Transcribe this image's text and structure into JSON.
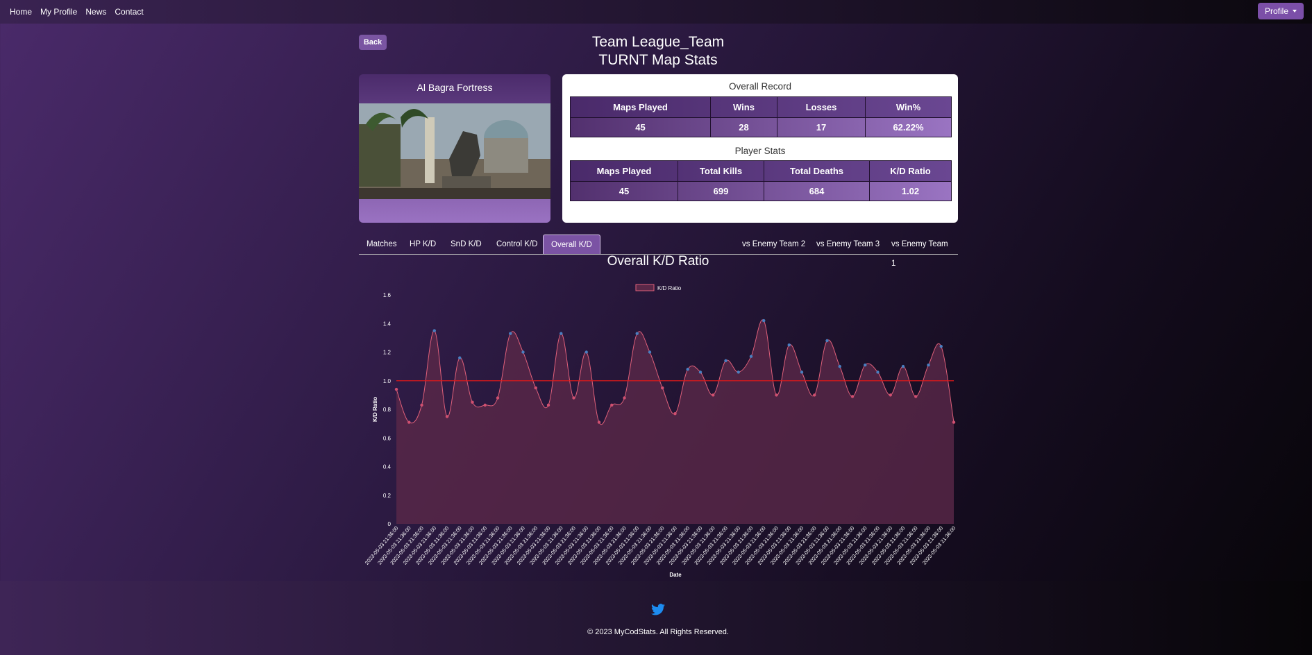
{
  "nav": {
    "links": [
      "Home",
      "My Profile",
      "News",
      "Contact"
    ],
    "profile": "Profile"
  },
  "back_label": "Back",
  "title_line1": "Team League_Team",
  "title_line2": "TURNT Map Stats",
  "map": {
    "name": "Al Bagra Fortress"
  },
  "overall_record": {
    "heading": "Overall Record",
    "headers": [
      "Maps Played",
      "Wins",
      "Losses",
      "Win%"
    ],
    "values": [
      "45",
      "28",
      "17",
      "62.22%"
    ]
  },
  "player_stats": {
    "heading": "Player Stats",
    "headers": [
      "Maps Played",
      "Total Kills",
      "Total Deaths",
      "K/D Ratio"
    ],
    "values": [
      "45",
      "699",
      "684",
      "1.02"
    ]
  },
  "tabs": {
    "left": [
      "Matches",
      "HP K/D",
      "SnD K/D",
      "Control K/D",
      "Overall K/D"
    ],
    "right": [
      "vs Enemy Team 2",
      "vs Enemy Team 3",
      "vs Enemy Team 1"
    ],
    "active": "Overall K/D"
  },
  "chart_title": "Overall K/D Ratio",
  "chart_data": {
    "type": "area",
    "legend": "K/D Ratio",
    "legend_position": "top",
    "xlabel": "Date",
    "ylabel": "K/D Ratio",
    "ylim": [
      0,
      1.6
    ],
    "yticks": [
      "0",
      "0.2",
      "0.4",
      "0.6",
      "0.8",
      "1.0",
      "1.2",
      "1.4",
      "1.6"
    ],
    "reference_line": 1.0,
    "x_tick_label": "2023-05-03 21:36:00",
    "values": [
      0.94,
      0.71,
      0.83,
      1.35,
      0.75,
      1.16,
      0.85,
      0.83,
      0.88,
      1.33,
      1.2,
      0.95,
      0.83,
      1.33,
      0.88,
      1.2,
      0.71,
      0.83,
      0.88,
      1.33,
      1.2,
      0.95,
      0.77,
      1.08,
      1.06,
      0.9,
      1.14,
      1.06,
      1.17,
      1.42,
      0.9,
      1.25,
      1.06,
      0.9,
      1.28,
      1.1,
      0.89,
      1.11,
      1.06,
      0.9,
      1.1,
      0.89,
      1.11,
      1.24,
      0.71
    ],
    "colors": {
      "fill": "#5a2848",
      "line": "#e0607a",
      "above_point": "#4a7fc0",
      "below_point": "#d05070",
      "reference": "#e01818"
    }
  },
  "footer": {
    "copyright": "© 2023 MyCodStats. All Rights Reserved.",
    "icon": "twitter-icon"
  }
}
